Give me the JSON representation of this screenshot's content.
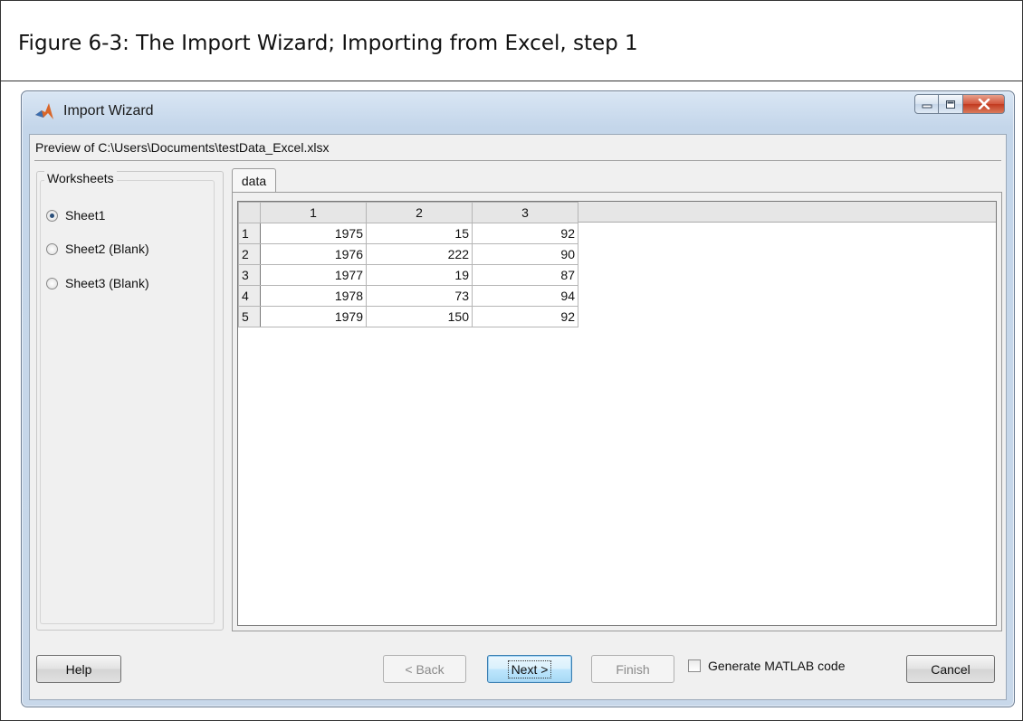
{
  "caption": "Figure 6-3: The Import Wizard; Importing from Excel, step 1",
  "window": {
    "title": "Import Wizard",
    "controls": {
      "minimize": "–",
      "maximize": "□",
      "close": "x"
    }
  },
  "preview_label": "Preview of C:\\Users\\Documents\\testData_Excel.xlsx",
  "worksheets": {
    "legend": "Worksheets",
    "items": [
      {
        "label": "Sheet1",
        "checked": true
      },
      {
        "label": "Sheet2 (Blank)",
        "checked": false
      },
      {
        "label": "Sheet3 (Blank)",
        "checked": false
      }
    ]
  },
  "tab": {
    "label": "data"
  },
  "grid": {
    "columns": [
      "1",
      "2",
      "3"
    ],
    "rows": [
      {
        "index": "1",
        "values": [
          "1975",
          "15",
          "92"
        ]
      },
      {
        "index": "2",
        "values": [
          "1976",
          "222",
          "90"
        ]
      },
      {
        "index": "3",
        "values": [
          "1977",
          "19",
          "87"
        ]
      },
      {
        "index": "4",
        "values": [
          "1978",
          "73",
          "94"
        ]
      },
      {
        "index": "5",
        "values": [
          "1979",
          "150",
          "92"
        ]
      }
    ]
  },
  "buttons": {
    "help": "Help",
    "back": "< Back",
    "next": "Next >",
    "finish": "Finish",
    "cancel": "Cancel"
  },
  "generate_code": {
    "label": "Generate MATLAB code",
    "checked": false
  }
}
